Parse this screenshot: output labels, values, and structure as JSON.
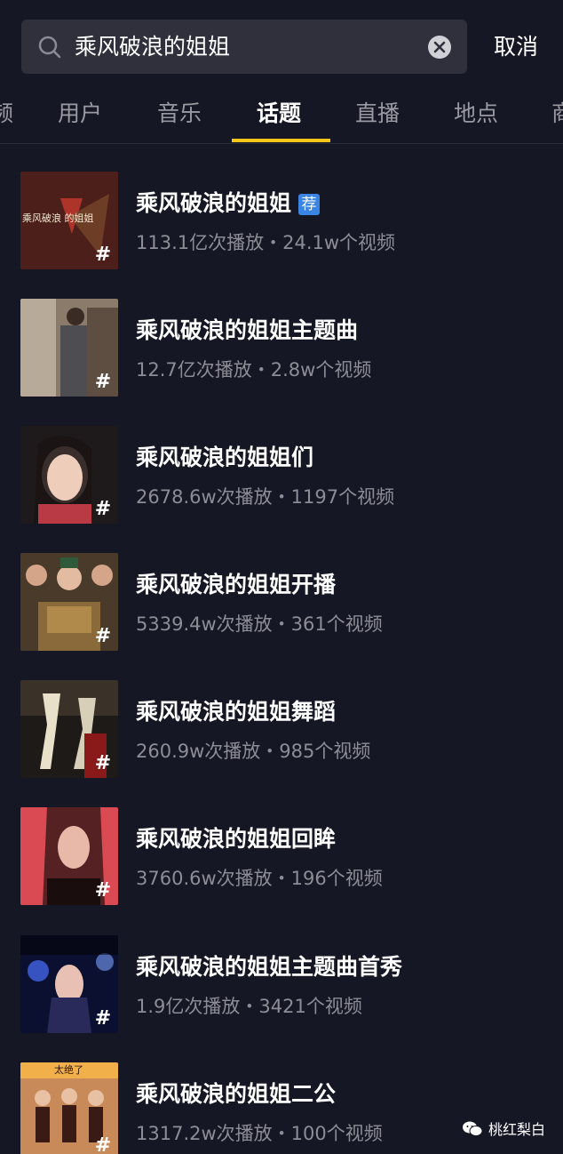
{
  "search": {
    "query": "乘风破浪的姐姐",
    "cancel_label": "取消"
  },
  "tabs": [
    {
      "label": "频"
    },
    {
      "label": "用户"
    },
    {
      "label": "音乐"
    },
    {
      "label": "话题",
      "active": true
    },
    {
      "label": "直播"
    },
    {
      "label": "地点"
    },
    {
      "label": "商"
    }
  ],
  "topics": [
    {
      "title": "乘风破浪的姐姐",
      "badge": "荐",
      "meta": "113.1亿次播放・24.1w个视频",
      "thumb_text": "乘风破浪 的姐姐"
    },
    {
      "title": "乘风破浪的姐姐主题曲",
      "meta": "12.7亿次播放・2.8w个视频"
    },
    {
      "title": "乘风破浪的姐姐们",
      "meta": "2678.6w次播放・1197个视频"
    },
    {
      "title": "乘风破浪的姐姐开播",
      "meta": "5339.4w次播放・361个视频"
    },
    {
      "title": "乘风破浪的姐姐舞蹈",
      "meta": "260.9w次播放・985个视频"
    },
    {
      "title": "乘风破浪的姐姐回眸",
      "meta": "3760.6w次播放・196个视频"
    },
    {
      "title": "乘风破浪的姐姐主题曲首秀",
      "meta": "1.9亿次播放・3421个视频"
    },
    {
      "title": "乘风破浪的姐姐二公",
      "meta": "1317.2w次播放・100个视频",
      "thumb_text": "太绝了"
    }
  ],
  "hash_symbol": "#",
  "watermark": {
    "label": "桃红梨白"
  },
  "colors": {
    "background": "#161724",
    "accent": "#f5c518",
    "badge": "#3a84e4",
    "meta_text": "#8c8d96"
  }
}
